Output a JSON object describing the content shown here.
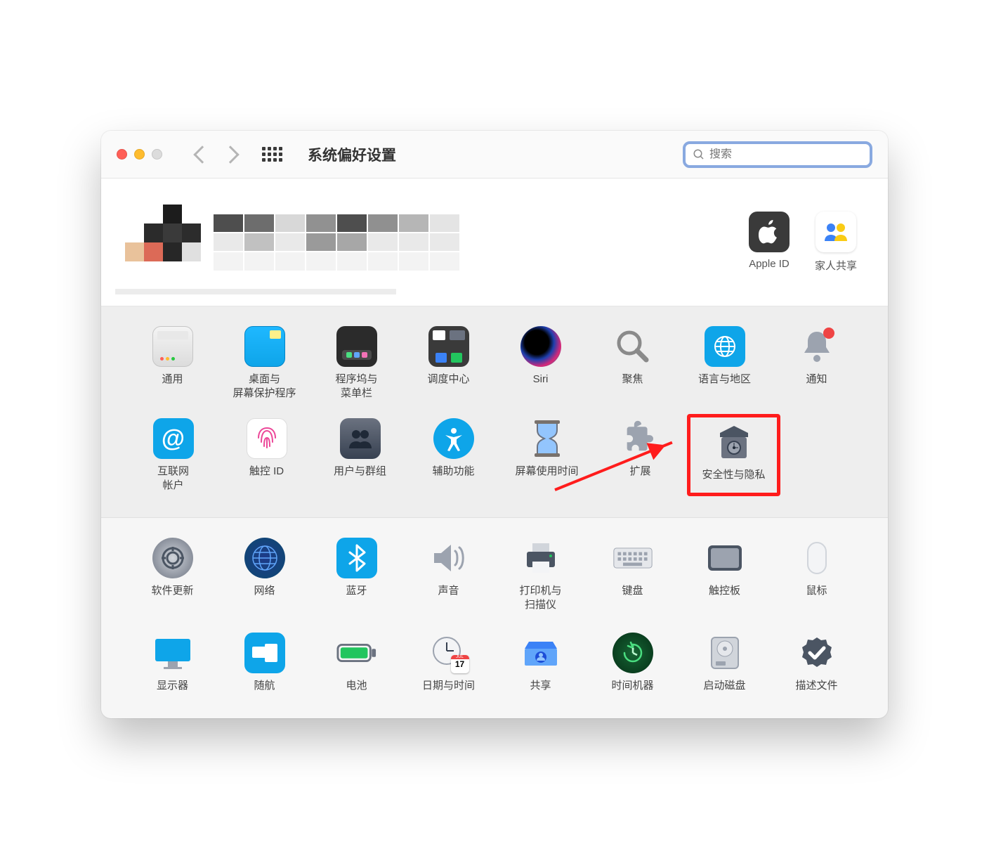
{
  "window": {
    "title": "系统偏好设置",
    "search_placeholder": "搜索"
  },
  "account": {
    "apple_id_label": "Apple ID",
    "family_label": "家人共享"
  },
  "sections": [
    {
      "rows": [
        [
          {
            "id": "general",
            "label": "通用"
          },
          {
            "id": "desktop",
            "label": "桌面与\n屏幕保护程序"
          },
          {
            "id": "dock",
            "label": "程序坞与\n菜单栏"
          },
          {
            "id": "mission",
            "label": "调度中心"
          },
          {
            "id": "siri",
            "label": "Siri"
          },
          {
            "id": "spotlight",
            "label": "聚焦"
          },
          {
            "id": "language",
            "label": "语言与地区"
          },
          {
            "id": "notifications",
            "label": "通知"
          }
        ],
        [
          {
            "id": "internet",
            "label": "互联网\n帐户"
          },
          {
            "id": "touchid",
            "label": "触控 ID"
          },
          {
            "id": "users",
            "label": "用户与群组"
          },
          {
            "id": "accessibility",
            "label": "辅助功能"
          },
          {
            "id": "screentime",
            "label": "屏幕使用时间"
          },
          {
            "id": "extensions",
            "label": "扩展"
          },
          {
            "id": "security",
            "label": "安全性与隐私",
            "highlight": true
          }
        ]
      ]
    },
    {
      "rows": [
        [
          {
            "id": "software",
            "label": "软件更新"
          },
          {
            "id": "network",
            "label": "网络"
          },
          {
            "id": "bluetooth",
            "label": "蓝牙"
          },
          {
            "id": "sound",
            "label": "声音"
          },
          {
            "id": "printers",
            "label": "打印机与\n扫描仪"
          },
          {
            "id": "keyboard",
            "label": "键盘"
          },
          {
            "id": "trackpad",
            "label": "触控板"
          },
          {
            "id": "mouse",
            "label": "鼠标"
          }
        ],
        [
          {
            "id": "displays",
            "label": "显示器"
          },
          {
            "id": "sidecar",
            "label": "随航"
          },
          {
            "id": "battery",
            "label": "电池"
          },
          {
            "id": "datetime",
            "label": "日期与时间"
          },
          {
            "id": "sharing",
            "label": "共享"
          },
          {
            "id": "timemachine",
            "label": "时间机器"
          },
          {
            "id": "startup",
            "label": "启动磁盘"
          },
          {
            "id": "profiles",
            "label": "描述文件"
          }
        ]
      ]
    }
  ]
}
